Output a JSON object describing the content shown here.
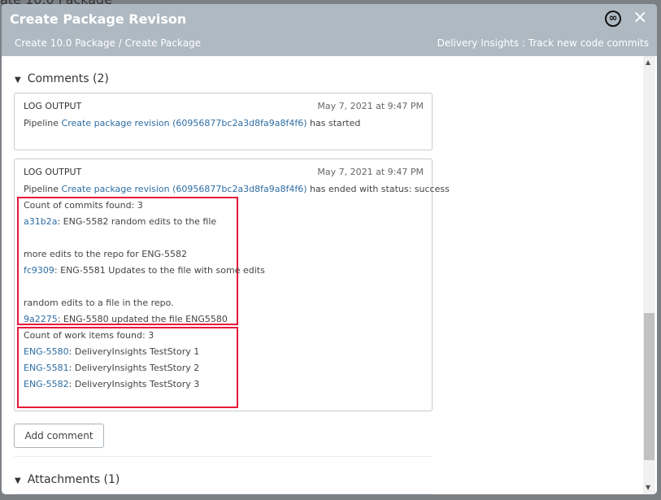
{
  "background_title": "ate 10.0 Package",
  "header": {
    "title": "Create Package Revison",
    "breadcrumb": "Create 10.0 Package / Create Package",
    "project": "Delivery Insights : Track new code commits",
    "logo_icon": "infinity-icon",
    "close_icon": "×"
  },
  "comments": {
    "heading": "Comments (2)",
    "items": [
      {
        "label": "LOG OUTPUT",
        "date": "May 7, 2021 at 9:47 PM",
        "prefix": "Pipeline ",
        "link": "Create package revision (60956877bc2a3d8fa9a8f4f6)",
        "suffix": " has started"
      },
      {
        "label": "LOG OUTPUT",
        "date": "May 7, 2021 at 9:47 PM",
        "prefix": "Pipeline ",
        "link": "Create package revision (60956877bc2a3d8fa9a8f4f6)",
        "suffix": " has ended with status: success",
        "commits_heading": "Count of commits found: 3",
        "commits": [
          {
            "hash": "a31b2a",
            "text": ": ENG-5582 random edits to the file"
          },
          {
            "text": "more edits to the repo for ENG-5582"
          },
          {
            "hash": "fc9309",
            "text": ": ENG-5581 Updates to the file with some edits"
          },
          {
            "text": "random edits to a file in the repo."
          },
          {
            "hash": "9a2275",
            "text": ": ENG-5580 updated the file ENG5580"
          }
        ],
        "work_heading": "Count of work items found: 3",
        "work_items": [
          {
            "id": "ENG-5580",
            "text": ": DeliveryInsights TestStory 1"
          },
          {
            "id": "ENG-5581",
            "text": ": DeliveryInsights TestStory 2"
          },
          {
            "id": "ENG-5582",
            "text": ": DeliveryInsights TestStory 3"
          }
        ]
      }
    ],
    "add_comment": "Add comment"
  },
  "attachments": {
    "heading": "Attachments (1)"
  },
  "colors": {
    "header": "#aeb9c2",
    "link": "#2e6da4",
    "highlight": "#e8173b"
  }
}
